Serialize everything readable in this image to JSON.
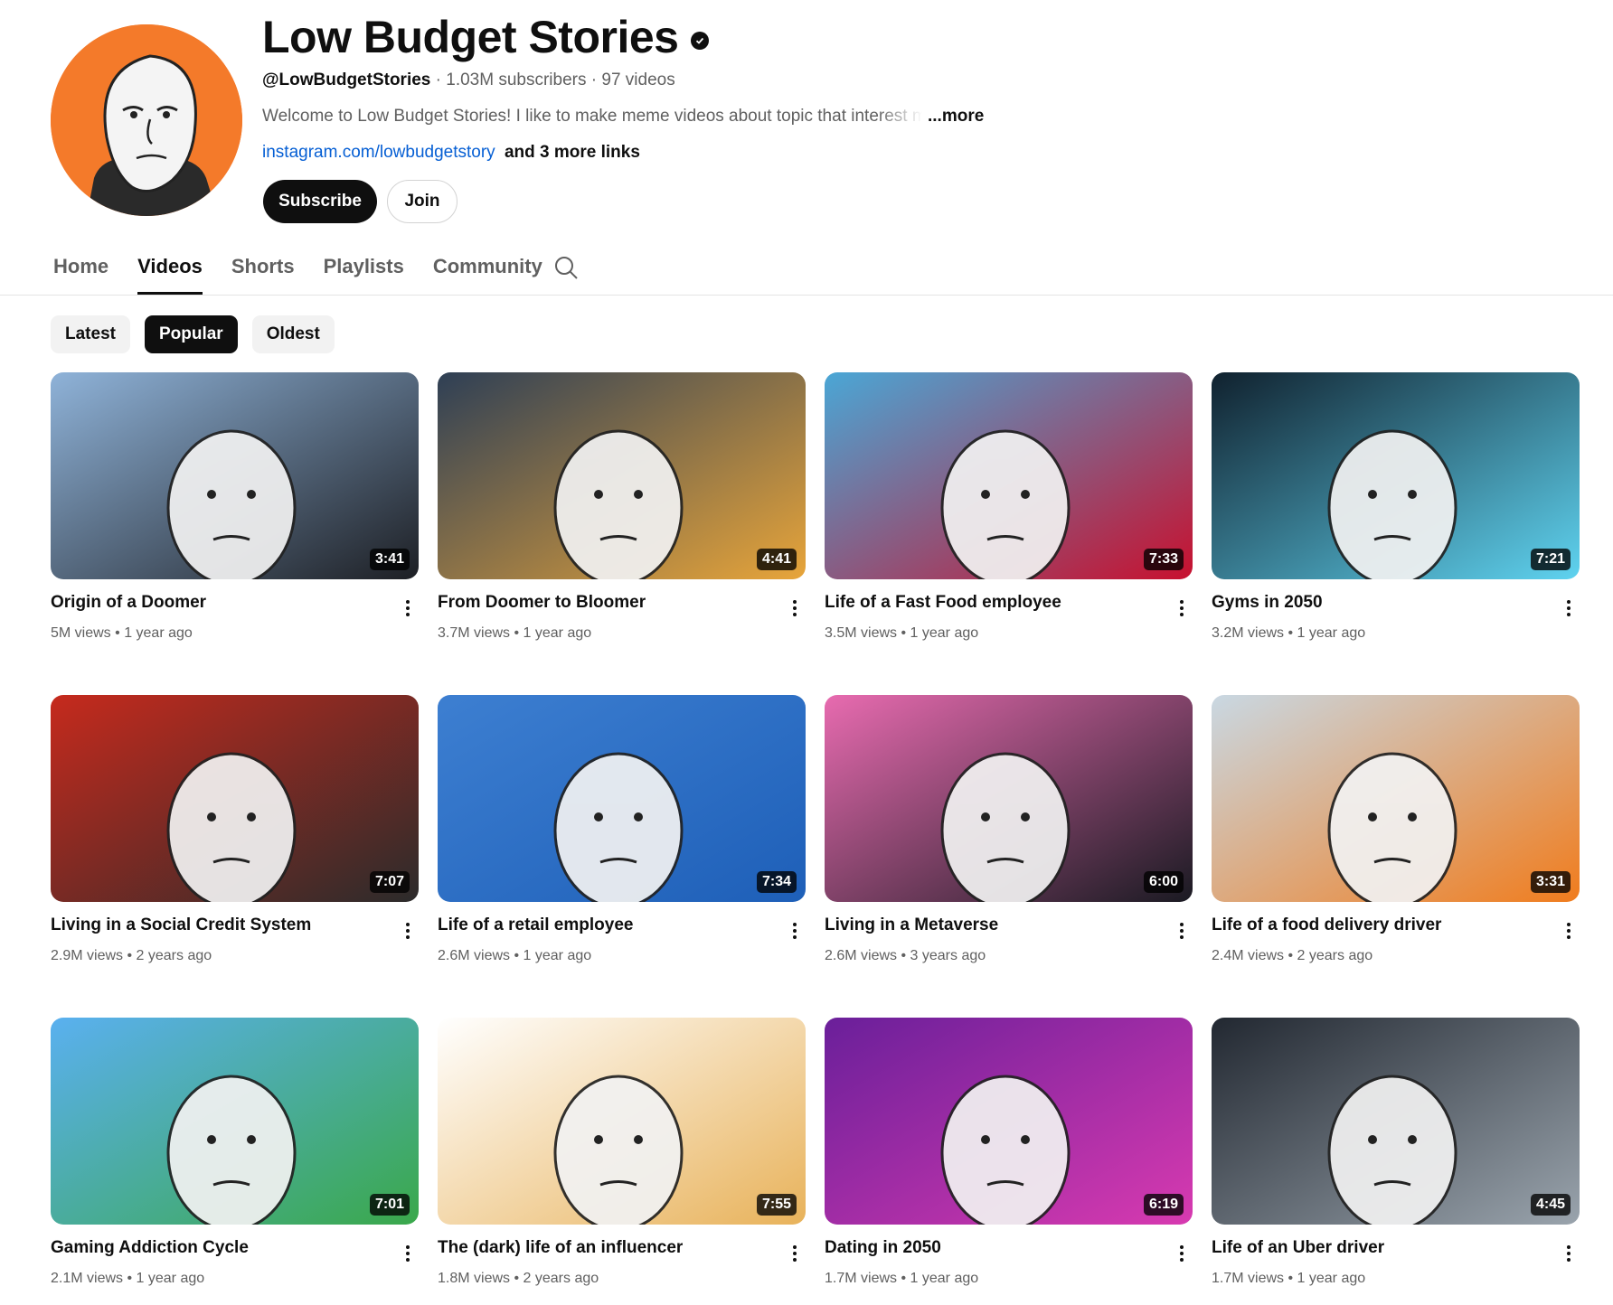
{
  "channel": {
    "name": "Low Budget Stories",
    "handle": "@LowBudgetStories",
    "stats": "· 1.03M subscribers · 97 videos",
    "description": "Welcome to Low Budget Stories! I like to make meme videos about topic that interest me",
    "more_label": "...more",
    "link": "instagram.com/lowbudgetstory",
    "more_links": "and 3 more links",
    "subscribe_label": "Subscribe",
    "join_label": "Join",
    "avatar_color": "#f47a2a"
  },
  "tabs": [
    {
      "label": "Home",
      "active": false
    },
    {
      "label": "Videos",
      "active": true
    },
    {
      "label": "Shorts",
      "active": false
    },
    {
      "label": "Playlists",
      "active": false
    },
    {
      "label": "Community",
      "active": false
    }
  ],
  "search_icon": "search-icon",
  "chips": [
    {
      "label": "Latest",
      "selected": false
    },
    {
      "label": "Popular",
      "selected": true
    },
    {
      "label": "Oldest",
      "selected": false
    }
  ],
  "videos": [
    {
      "title": "Origin of a Doomer",
      "views": "5M views",
      "age": "1 year ago",
      "duration": "3:41",
      "colors": [
        "#8fb3d9",
        "#1d1f24"
      ]
    },
    {
      "title": "From Doomer to Bloomer",
      "views": "3.7M views",
      "age": "1 year ago",
      "duration": "4:41",
      "colors": [
        "#2e3f55",
        "#e8a53a"
      ]
    },
    {
      "title": "Life of a Fast Food employee",
      "views": "3.5M views",
      "age": "1 year ago",
      "duration": "7:33",
      "colors": [
        "#4aa7d6",
        "#c8102e"
      ]
    },
    {
      "title": "Gyms in 2050",
      "views": "3.2M views",
      "age": "1 year ago",
      "duration": "7:21",
      "colors": [
        "#10212e",
        "#5fd3f0"
      ]
    },
    {
      "title": "Living in a Social Credit System",
      "views": "2.9M views",
      "age": "2 years ago",
      "duration": "7:07",
      "colors": [
        "#c62a1d",
        "#2b2b2b"
      ]
    },
    {
      "title": "Life of a retail employee",
      "views": "2.6M views",
      "age": "1 year ago",
      "duration": "7:34",
      "colors": [
        "#3d7fd1",
        "#1e5fb8"
      ]
    },
    {
      "title": "Living in a Metaverse",
      "views": "2.6M views",
      "age": "3 years ago",
      "duration": "6:00",
      "colors": [
        "#e86bb0",
        "#1a1a22"
      ]
    },
    {
      "title": "Life of a food delivery driver",
      "views": "2.4M views",
      "age": "2 years ago",
      "duration": "3:31",
      "colors": [
        "#c9d8e3",
        "#f07c1d"
      ]
    },
    {
      "title": "Gaming Addiction Cycle",
      "views": "2.1M views",
      "age": "1 year ago",
      "duration": "7:01",
      "colors": [
        "#5ab0f0",
        "#3aa84a"
      ]
    },
    {
      "title": "The (dark) life of an influencer",
      "views": "1.8M views",
      "age": "2 years ago",
      "duration": "7:55",
      "colors": [
        "#ffffff",
        "#e8b25a"
      ]
    },
    {
      "title": "Dating in 2050",
      "views": "1.7M views",
      "age": "1 year ago",
      "duration": "6:19",
      "colors": [
        "#6a1f9a",
        "#d83ab0"
      ]
    },
    {
      "title": "Life of an Uber driver",
      "views": "1.7M views",
      "age": "1 year ago",
      "duration": "4:45",
      "colors": [
        "#222831",
        "#9aa4ad"
      ]
    }
  ]
}
